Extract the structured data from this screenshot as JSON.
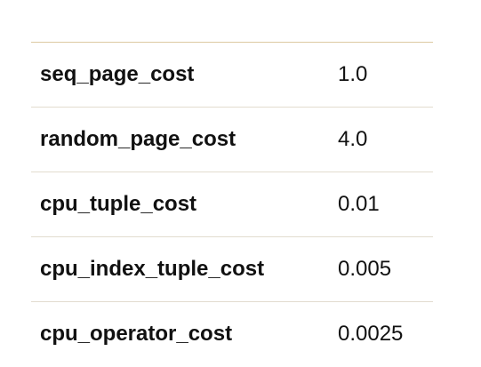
{
  "table": {
    "rows": [
      {
        "name": "seq_page_cost",
        "value": "1.0"
      },
      {
        "name": "random_page_cost",
        "value": "4.0"
      },
      {
        "name": "cpu_tuple_cost",
        "value": "0.01"
      },
      {
        "name": "cpu_index_tuple_cost",
        "value": "0.005"
      },
      {
        "name": "cpu_operator_cost",
        "value": "0.0025"
      }
    ]
  }
}
